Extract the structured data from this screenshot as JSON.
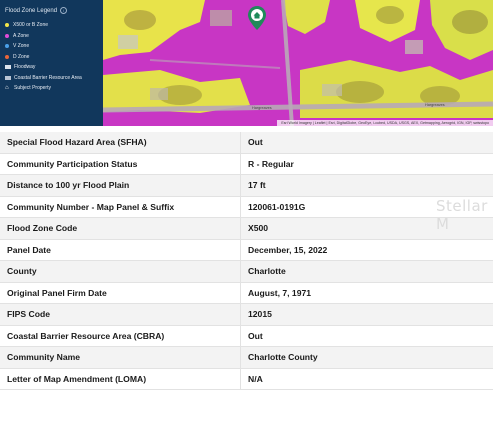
{
  "legend": {
    "title": "Flood Zone Legend",
    "items": [
      {
        "label": "X500 or B Zone",
        "icon": "yellow-dot",
        "color": "#f2e64a"
      },
      {
        "label": "A Zone",
        "icon": "magenta-dot",
        "color": "#e04bd8"
      },
      {
        "label": "V Zone",
        "icon": "blue-dot",
        "color": "#4aa0e8"
      },
      {
        "label": "D Zone",
        "icon": "orange-dot",
        "color": "#e8663a"
      },
      {
        "label": "Floodway",
        "icon": "floodway-swatch"
      },
      {
        "label": "Coastal Barrier Resource Area",
        "icon": "cbra-swatch"
      },
      {
        "label": "Subject Property",
        "icon": "home-icon"
      }
    ]
  },
  "map": {
    "road_labels": [
      "Hargreaves",
      "Hargreaves"
    ],
    "attribution": "Esri World Imagery | Leaflet | Esri, DigitalGlobe, GeoEye, i-cubed, USDA, USGS, AEX, Getmapping, Aerogrid, IGN, IGP, swisstopo"
  },
  "watermark": "Stellar M",
  "rows": [
    {
      "label": "Special Flood Hazard Area (SFHA)",
      "value": "Out"
    },
    {
      "label": "Community Participation Status",
      "value": "R - Regular"
    },
    {
      "label": "Distance to 100 yr Flood Plain",
      "value": "17 ft"
    },
    {
      "label": "Community Number - Map Panel & Suffix",
      "value": "120061-0191G"
    },
    {
      "label": "Flood Zone Code",
      "value": "X500"
    },
    {
      "label": "Panel Date",
      "value": "December, 15, 2022"
    },
    {
      "label": "County",
      "value": "Charlotte"
    },
    {
      "label": "Original Panel Firm Date",
      "value": "August, 7, 1971"
    },
    {
      "label": "FIPS Code",
      "value": "12015"
    },
    {
      "label": "Coastal Barrier Resource Area (CBRA)",
      "value": "Out"
    },
    {
      "label": "Community Name",
      "value": "Charlotte County"
    },
    {
      "label": "Letter of Map Amendment (LOMA)",
      "value": "N/A"
    }
  ]
}
